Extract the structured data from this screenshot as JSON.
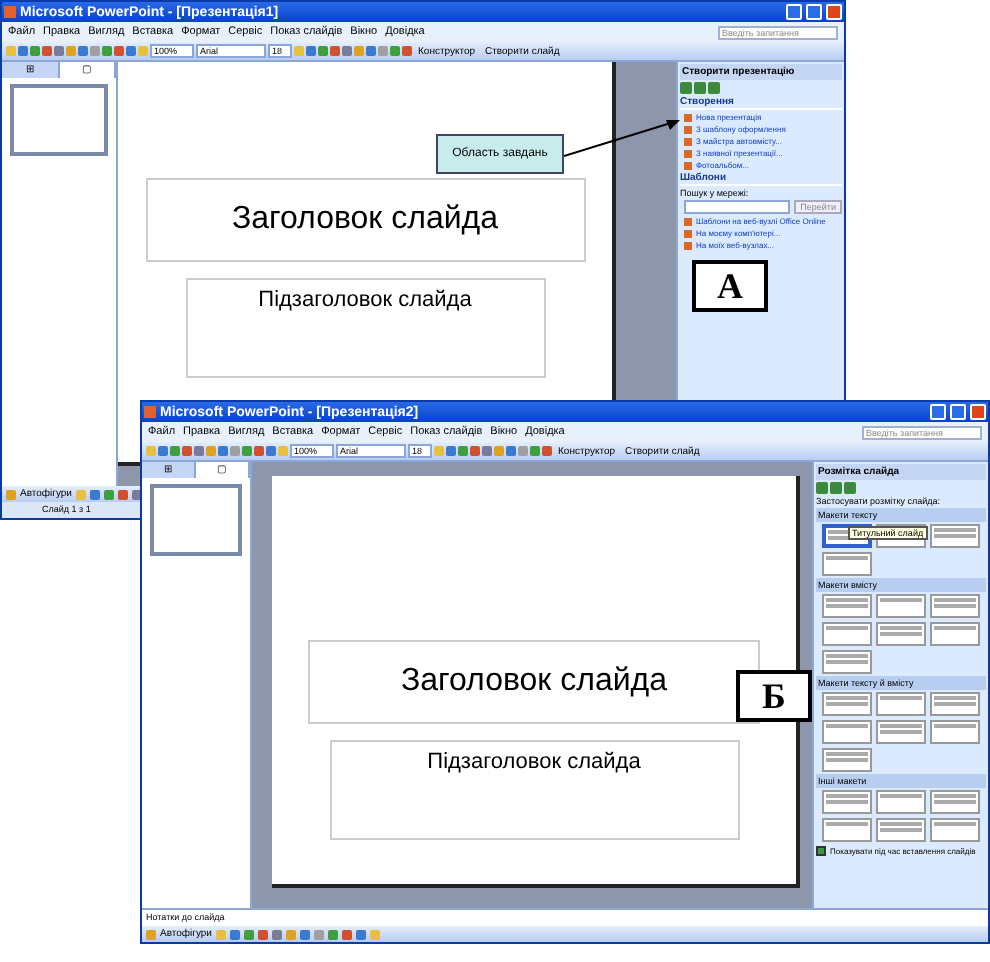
{
  "windows": [
    {
      "title": "Microsoft PowerPoint - [Презентація1]",
      "search_placeholder": "Введіть запитання",
      "menu": [
        "Файл",
        "Правка",
        "Вигляд",
        "Вставка",
        "Формат",
        "Сервіс",
        "Показ слайдів",
        "Вікно",
        "Довідка"
      ],
      "toolbar": {
        "zoom": "100%",
        "font": "Arial",
        "size": "18",
        "buttons": [
          "Конструктор",
          "Створити слайд"
        ]
      },
      "pane_tabs": [
        {
          "label": "⊞",
          "selected": false
        },
        {
          "label": "▢",
          "selected": true
        }
      ],
      "slide": {
        "title": "Заголовок слайда",
        "subtitle": "Підзаголовок слайда"
      },
      "task_pane": {
        "kind": "create",
        "title": "Створити презентацію",
        "sections": [
          {
            "heading": "Створення",
            "links": [
              "Нова презентація",
              "З шаблону оформлення",
              "З майстра автовмісту...",
              "З наявної презентації...",
              "Фотоальбом..."
            ]
          },
          {
            "heading": "Шаблони",
            "search_label": "Пошук у мережі:",
            "search_button": "Перейти",
            "links": [
              "Шаблони на веб-вузлі Office Online",
              "На моєму комп'ютері...",
              "На моїх веб-вузлах..."
            ]
          }
        ]
      },
      "drawing_toolbar": "Автофігури",
      "status": "Слайд 1 з 1"
    },
    {
      "title": "Microsoft PowerPoint - [Презентація2]",
      "search_placeholder": "Введіть запитання",
      "menu": [
        "Файл",
        "Правка",
        "Вигляд",
        "Вставка",
        "Формат",
        "Сервіс",
        "Показ слайдів",
        "Вікно",
        "Довідка"
      ],
      "toolbar": {
        "zoom": "100%",
        "font": "Arial",
        "size": "18",
        "buttons": [
          "Конструктор",
          "Створити слайд"
        ]
      },
      "pane_tabs": [
        {
          "label": "⊞",
          "selected": false
        },
        {
          "label": "▢",
          "selected": true
        }
      ],
      "slide": {
        "title": "Заголовок слайда",
        "subtitle": "Підзаголовок слайда"
      },
      "notes": "Нотатки до слайда",
      "task_pane": {
        "kind": "layout",
        "title": "Розмітка слайда",
        "apply_label": "Застосувати розмітку слайда:",
        "tooltip": "Титульний слайд",
        "groups": [
          {
            "heading": "Макети тексту",
            "layouts": [
              {
                "selected": true
              },
              {
                "selected": false
              },
              {
                "selected": false
              },
              {
                "selected": false
              }
            ]
          },
          {
            "heading": "Макети вмісту",
            "layouts": [
              {
                "selected": false
              },
              {
                "selected": false
              },
              {
                "selected": false
              },
              {
                "selected": false
              },
              {
                "selected": false
              },
              {
                "selected": false
              },
              {
                "selected": false
              }
            ]
          },
          {
            "heading": "Макети тексту й вмісту",
            "layouts": [
              {
                "selected": false
              },
              {
                "selected": false
              },
              {
                "selected": false
              },
              {
                "selected": false
              },
              {
                "selected": false
              },
              {
                "selected": false
              },
              {
                "selected": false
              }
            ]
          },
          {
            "heading": "Інші макети",
            "layouts": [
              {
                "selected": false
              },
              {
                "selected": false
              },
              {
                "selected": false
              },
              {
                "selected": false
              },
              {
                "selected": false
              },
              {
                "selected": false
              }
            ]
          }
        ],
        "show_on_insert": {
          "label": "Показувати під час вставлення слайдів",
          "checked": true
        }
      },
      "drawing_toolbar": "Автофігури"
    }
  ],
  "callout": "Область завдань",
  "labels": [
    "А",
    "Б"
  ]
}
